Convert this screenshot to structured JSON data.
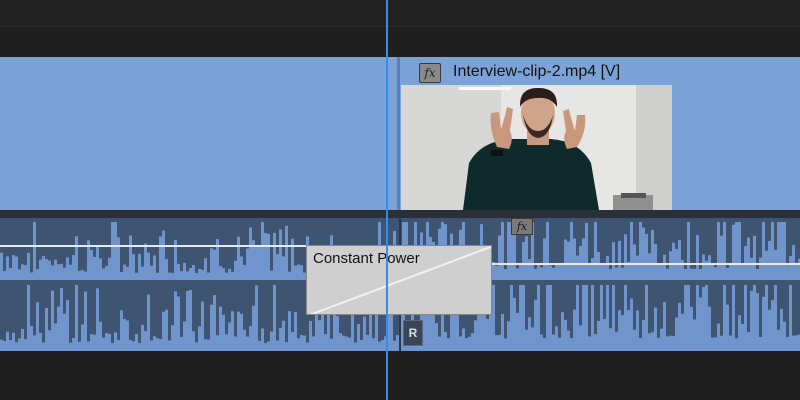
{
  "timeline": {
    "video_clip": {
      "title": "Interview-clip-2.mp4 [V]",
      "fx_label": "fx",
      "color": "#7ba3d8"
    },
    "audio_clip": {
      "fx_label": "fx",
      "color": "#3e5470",
      "waveform_color": "#6f95cc"
    },
    "transition": {
      "label": "Constant Power"
    },
    "keyframe_badge": "R",
    "playhead_color": "#2f8ef0"
  }
}
